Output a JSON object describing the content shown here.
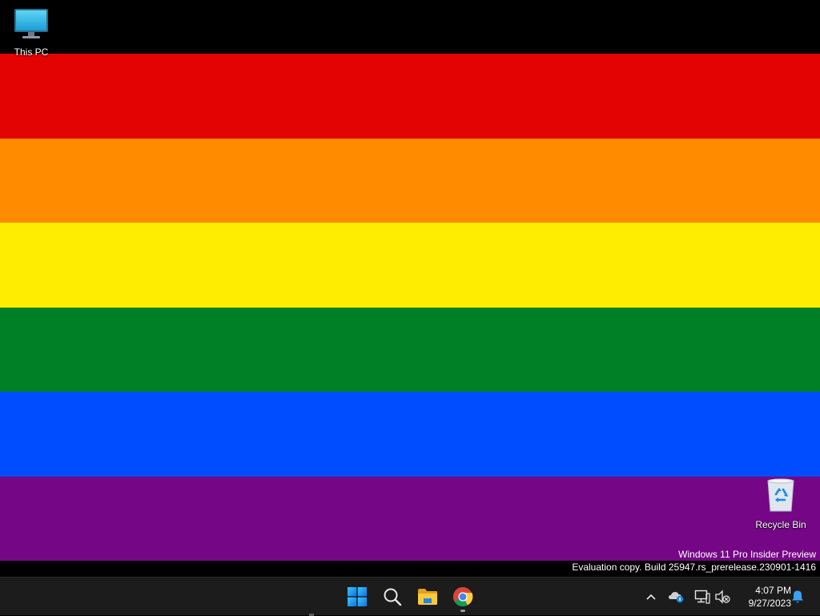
{
  "desktop": {
    "background": "rainbow-flag",
    "stripes": [
      "#e40303",
      "#ff8c00",
      "#ffed00",
      "#008026",
      "#004dff",
      "#750787"
    ],
    "icons": [
      {
        "name": "this-pc",
        "label": "This PC",
        "icon": "monitor-icon"
      },
      {
        "name": "recycle-bin",
        "label": "Recycle Bin",
        "icon": "recycle-bin-icon"
      }
    ],
    "watermark": {
      "line1": "Windows 11 Pro Insider Preview",
      "line2": "Evaluation copy. Build 25947.rs_prerelease.230901-1416"
    }
  },
  "taskbar": {
    "background": "#1c1c1c",
    "pinned": [
      {
        "name": "start",
        "icon": "windows-logo-icon"
      },
      {
        "name": "search",
        "icon": "search-icon"
      },
      {
        "name": "file-explorer",
        "icon": "folder-icon"
      },
      {
        "name": "chrome",
        "icon": "chrome-icon",
        "running": true
      }
    ],
    "tray": {
      "icons": [
        "chevron-up-icon",
        "onedrive-icon",
        "network-icon",
        "volume-muted-icon",
        "notification-bell-icon"
      ],
      "time": "4:07 PM",
      "date": "9/27/2023"
    }
  }
}
